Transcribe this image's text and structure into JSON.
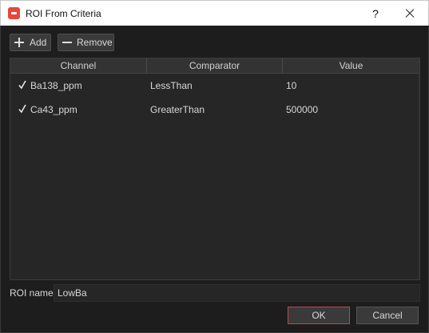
{
  "window": {
    "title": "ROI From Criteria",
    "help_label": "?"
  },
  "toolbar": {
    "add_label": "Add",
    "remove_label": "Remove"
  },
  "table": {
    "columns": [
      "Channel",
      "Comparator",
      "Value"
    ],
    "rows": [
      {
        "checked": true,
        "channel": "Ba138_ppm",
        "comparator": "LessThan",
        "value": "10"
      },
      {
        "checked": true,
        "channel": "Ca43_ppm",
        "comparator": "GreaterThan",
        "value": "500000"
      }
    ]
  },
  "roi": {
    "label": "ROI name:",
    "value": "LowBa"
  },
  "buttons": {
    "ok_label": "OK",
    "cancel_label": "Cancel"
  },
  "colors": {
    "accent_border": "#b84a4a",
    "app_icon": "#e8473a",
    "background": "#1d1d1d"
  },
  "icons": {
    "add": "plus-icon",
    "remove": "minus-icon",
    "row_check": "checkmark-icon",
    "close": "close-icon"
  }
}
